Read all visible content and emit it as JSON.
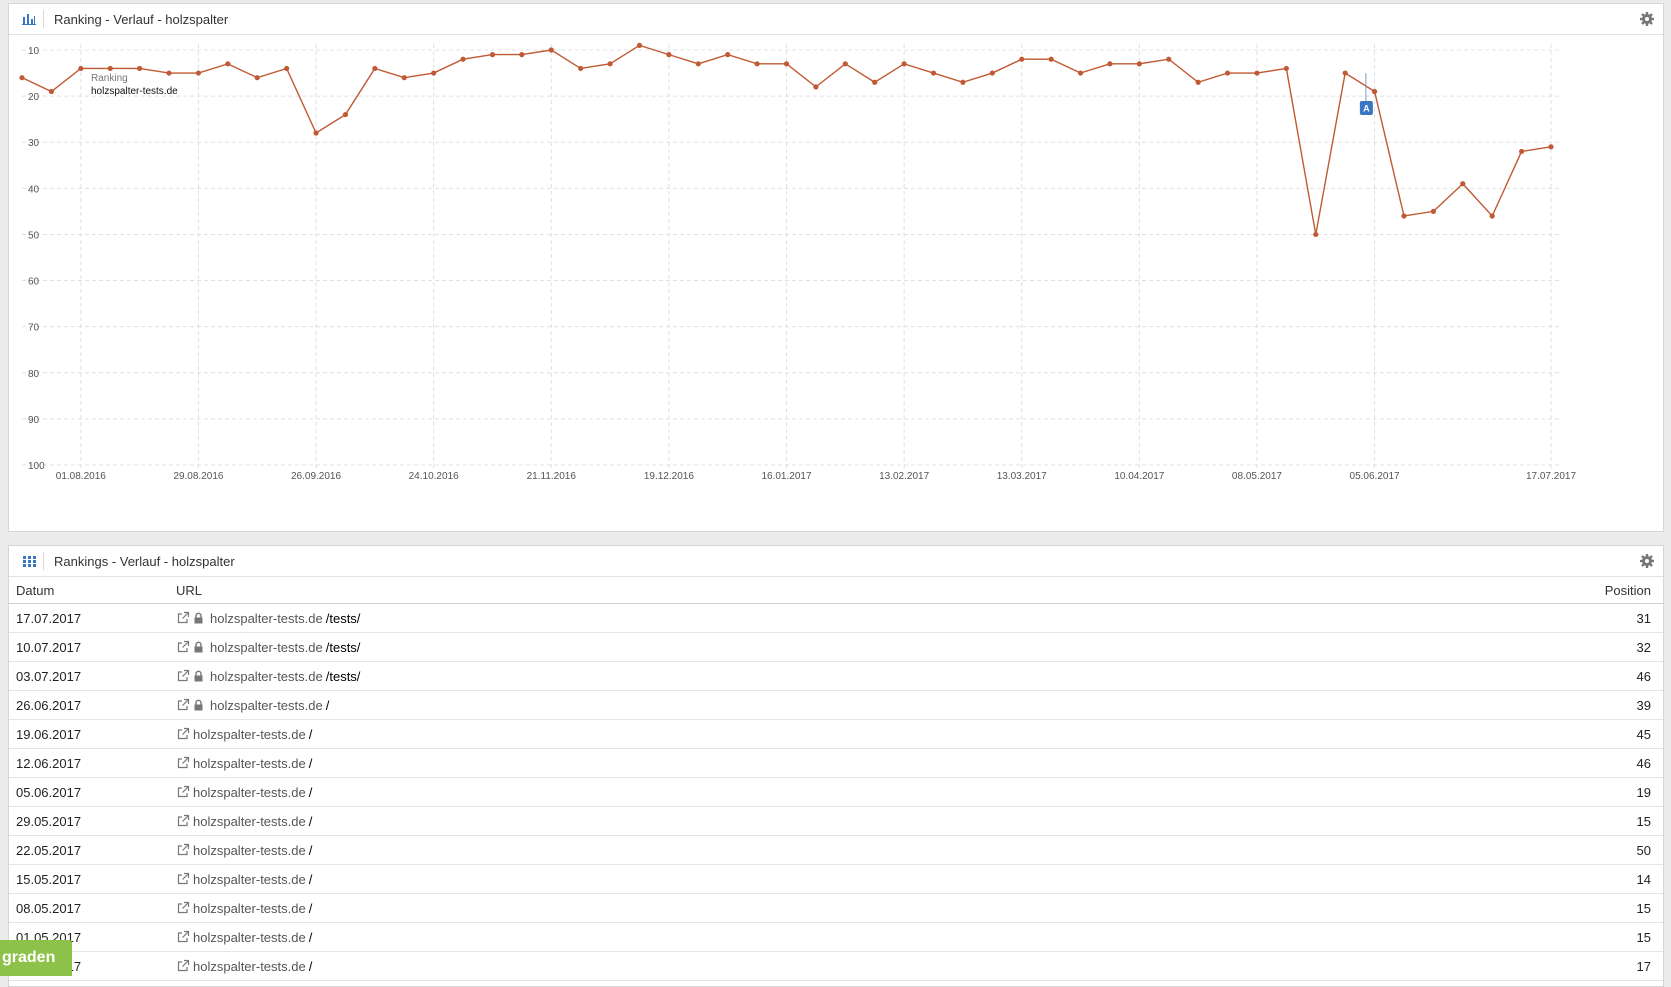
{
  "chart_panel": {
    "title": "Ranking - Verlauf - holzspalter"
  },
  "table_panel": {
    "title": "Rankings - Verlauf - holzspalter"
  },
  "colors": {
    "line": "#c05a34",
    "annotation": "#3a76c4",
    "upgrade": "#8dc24a"
  },
  "chart_data": {
    "type": "line",
    "y_reversed": true,
    "ylim": [
      10,
      100
    ],
    "yticks": [
      10,
      20,
      30,
      40,
      50,
      60,
      70,
      80,
      90,
      100
    ],
    "x_tick_labels": [
      "01.08.2016",
      "29.08.2016",
      "26.09.2016",
      "24.10.2016",
      "21.11.2016",
      "19.12.2016",
      "16.01.2017",
      "13.02.2017",
      "13.03.2017",
      "10.04.2017",
      "08.05.2017",
      "05.06.2017",
      "17.07.2017"
    ],
    "x_tick_weeks": [
      2,
      6,
      10,
      14,
      18,
      22,
      26,
      30,
      34,
      38,
      42,
      46,
      52
    ],
    "grid": true,
    "legend": {
      "label": "Ranking",
      "name": "holzspalter-tests.de",
      "placement": "top-left"
    },
    "annotation": {
      "label": "A",
      "week": 45.5
    },
    "series": [
      {
        "name": "holzspalter-tests.de",
        "values": [
          16,
          19,
          14,
          14,
          14,
          15,
          15,
          13,
          16,
          14,
          28,
          24,
          14,
          16,
          15,
          12,
          11,
          11,
          10,
          14,
          13,
          9,
          11,
          13,
          11,
          13,
          13,
          18,
          13,
          17,
          13,
          15,
          17,
          15,
          12,
          12,
          15,
          13,
          13,
          12,
          17,
          15,
          15,
          14,
          50,
          15,
          19,
          46,
          45,
          39,
          46,
          32,
          31
        ]
      }
    ]
  },
  "table": {
    "headers": {
      "date": "Datum",
      "url": "URL",
      "position": "Position"
    },
    "rows": [
      {
        "date": "17.07.2017",
        "domain": "holzspalter-tests.de",
        "path": "/tests/",
        "position": "31",
        "secure": true
      },
      {
        "date": "10.07.2017",
        "domain": "holzspalter-tests.de",
        "path": "/tests/",
        "position": "32",
        "secure": true
      },
      {
        "date": "03.07.2017",
        "domain": "holzspalter-tests.de",
        "path": "/tests/",
        "position": "46",
        "secure": true
      },
      {
        "date": "26.06.2017",
        "domain": "holzspalter-tests.de",
        "path": "/",
        "position": "39",
        "secure": true
      },
      {
        "date": "19.06.2017",
        "domain": "holzspalter-tests.de",
        "path": "/",
        "position": "45",
        "secure": false
      },
      {
        "date": "12.06.2017",
        "domain": "holzspalter-tests.de",
        "path": "/",
        "position": "46",
        "secure": false
      },
      {
        "date": "05.06.2017",
        "domain": "holzspalter-tests.de",
        "path": "/",
        "position": "19",
        "secure": false
      },
      {
        "date": "29.05.2017",
        "domain": "holzspalter-tests.de",
        "path": "/",
        "position": "15",
        "secure": false
      },
      {
        "date": "22.05.2017",
        "domain": "holzspalter-tests.de",
        "path": "/",
        "position": "50",
        "secure": false
      },
      {
        "date": "15.05.2017",
        "domain": "holzspalter-tests.de",
        "path": "/",
        "position": "14",
        "secure": false
      },
      {
        "date": "08.05.2017",
        "domain": "holzspalter-tests.de",
        "path": "/",
        "position": "15",
        "secure": false
      },
      {
        "date": "01.05.2017",
        "domain": "holzspalter-tests.de",
        "path": "/",
        "position": "15",
        "secure": false
      },
      {
        "date": "24.04.2017",
        "domain": "holzspalter-tests.de",
        "path": "/",
        "position": "17",
        "secure": false
      }
    ]
  },
  "upgrade_badge": {
    "label": "graden"
  }
}
